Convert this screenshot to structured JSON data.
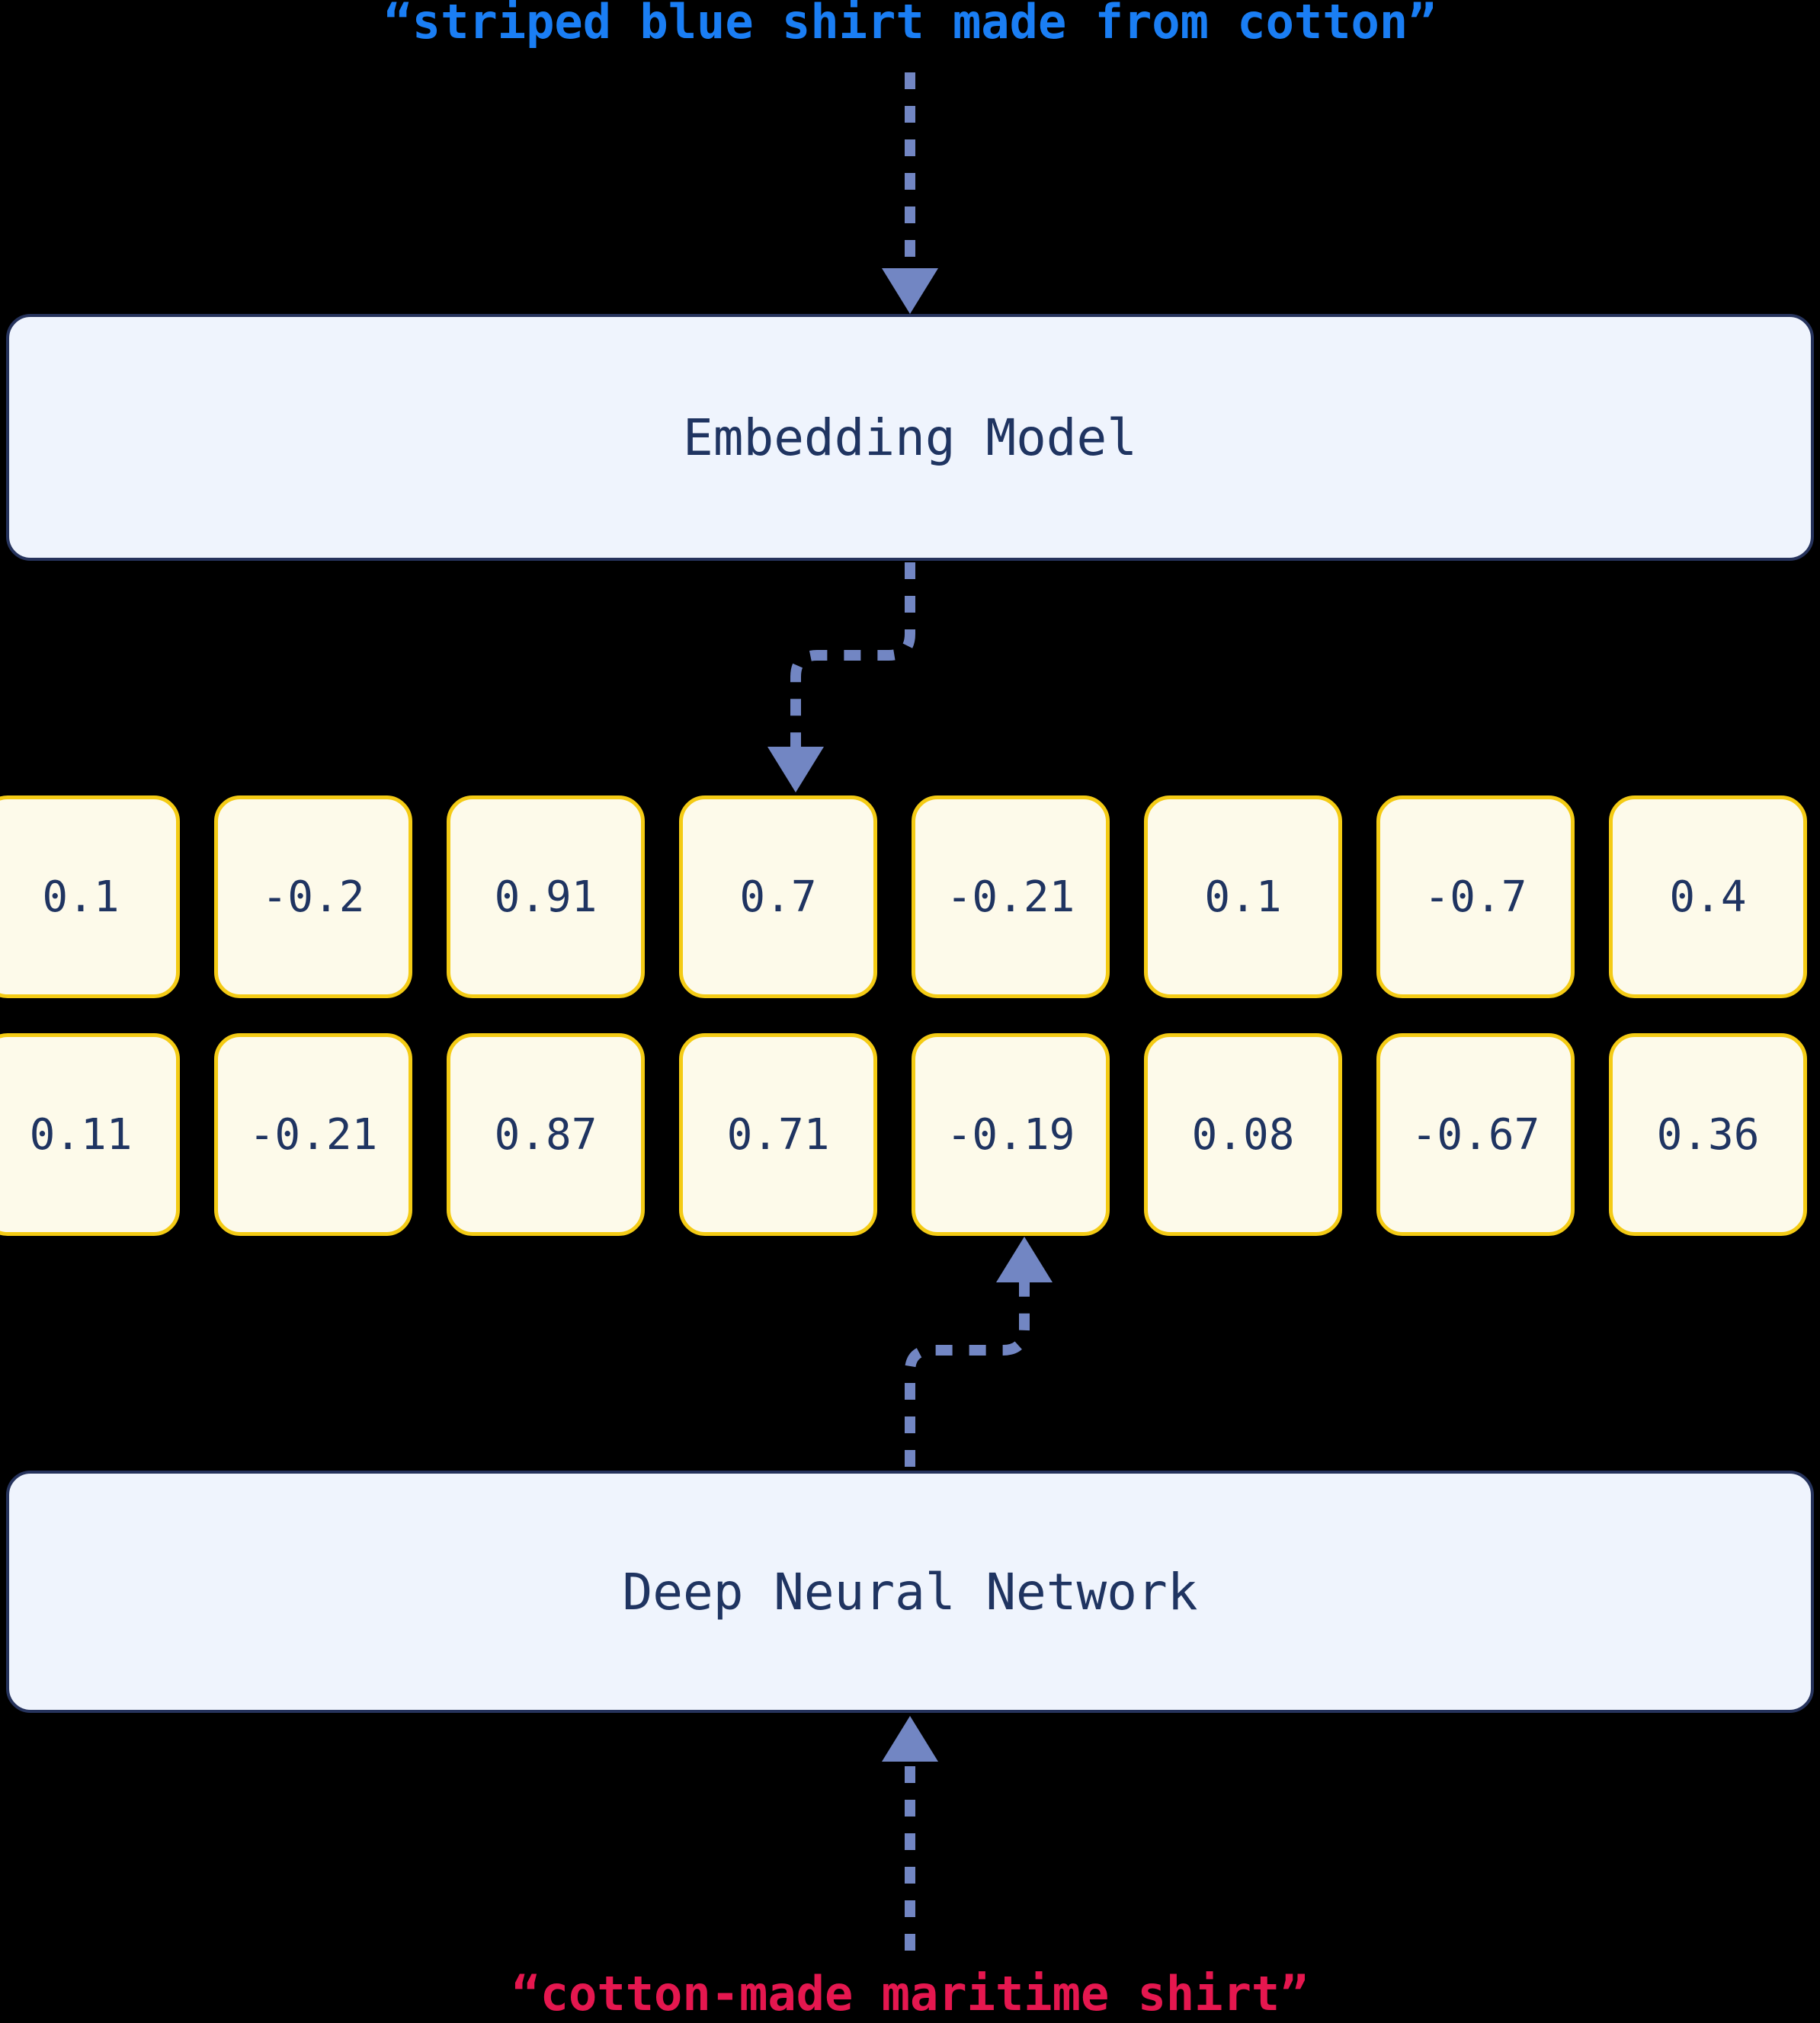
{
  "diagram": {
    "title_top": "“striped blue shirt made from cotton”",
    "title_bottom": "“cotton-made maritime shirt”",
    "colors": {
      "background": "#000000",
      "query_text": "#1a7ef4",
      "document_text": "#e5174f",
      "process_box_fill": "#eff4fd",
      "process_box_border": "#26335c",
      "process_box_text": "#1f3461",
      "vector_cell_fill": "#fdfaea",
      "vector_cell_border": "#f4cb15",
      "vector_cell_text": "#1f3461",
      "arrow": "#7286c3"
    }
  },
  "nodes": {
    "embedding_model": {
      "label": "Embedding Model"
    },
    "deep_neural_network": {
      "label": "Deep Neural Network"
    }
  },
  "vectors": {
    "query_embedding": {
      "values": [
        "0.1",
        "-0.2",
        "0.91",
        "0.7",
        "-0.21",
        "0.1",
        "-0.7",
        "0.4"
      ]
    },
    "document_embedding": {
      "values": [
        "0.11",
        "-0.21",
        "0.87",
        "0.71",
        "-0.19",
        "0.08",
        "-0.67",
        "0.36"
      ]
    }
  },
  "connectors": [
    {
      "name": "query-to-embedding-model",
      "style": "dashed",
      "direction": "down"
    },
    {
      "name": "embedding-model-to-query-vector",
      "style": "dashed-elbow",
      "direction": "down-left"
    },
    {
      "name": "document-vector-to-dnn",
      "style": "dashed-elbow",
      "direction": "up-right"
    },
    {
      "name": "document-to-dnn",
      "style": "dashed",
      "direction": "up"
    }
  ]
}
